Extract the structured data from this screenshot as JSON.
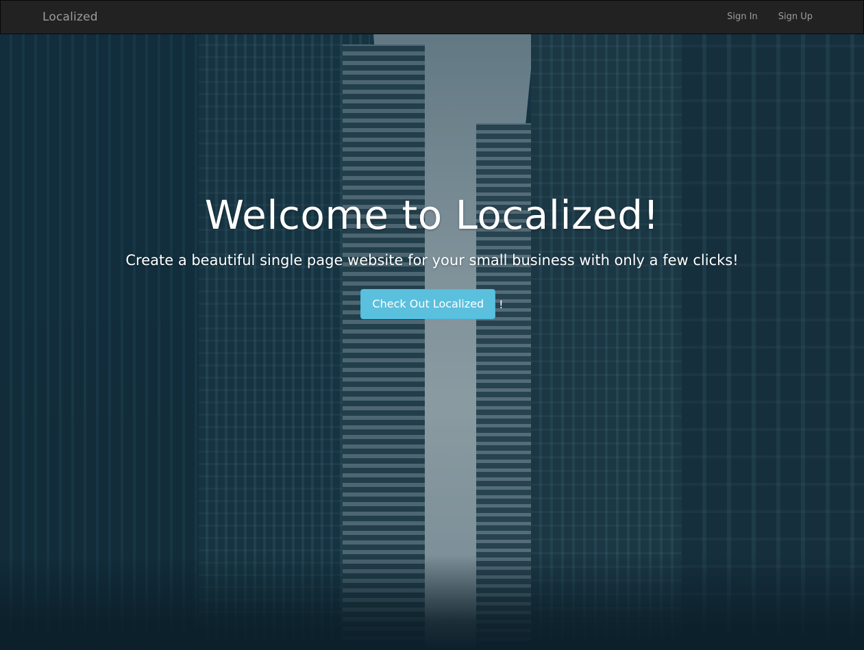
{
  "navbar": {
    "brand": "Localized",
    "links": [
      {
        "label": "Sign In"
      },
      {
        "label": "Sign Up"
      }
    ]
  },
  "hero": {
    "title": "Welcome to Localized!",
    "subtitle": "Create a beautiful single page website for your small business with only a few clicks!",
    "cta_label": "Check Out Localized",
    "cta_suffix": "!"
  },
  "colors": {
    "navbar_bg": "#222222",
    "nav_text": "#9d9d9d",
    "cta_bg": "#5bc0de",
    "hero_text": "#ffffff"
  }
}
